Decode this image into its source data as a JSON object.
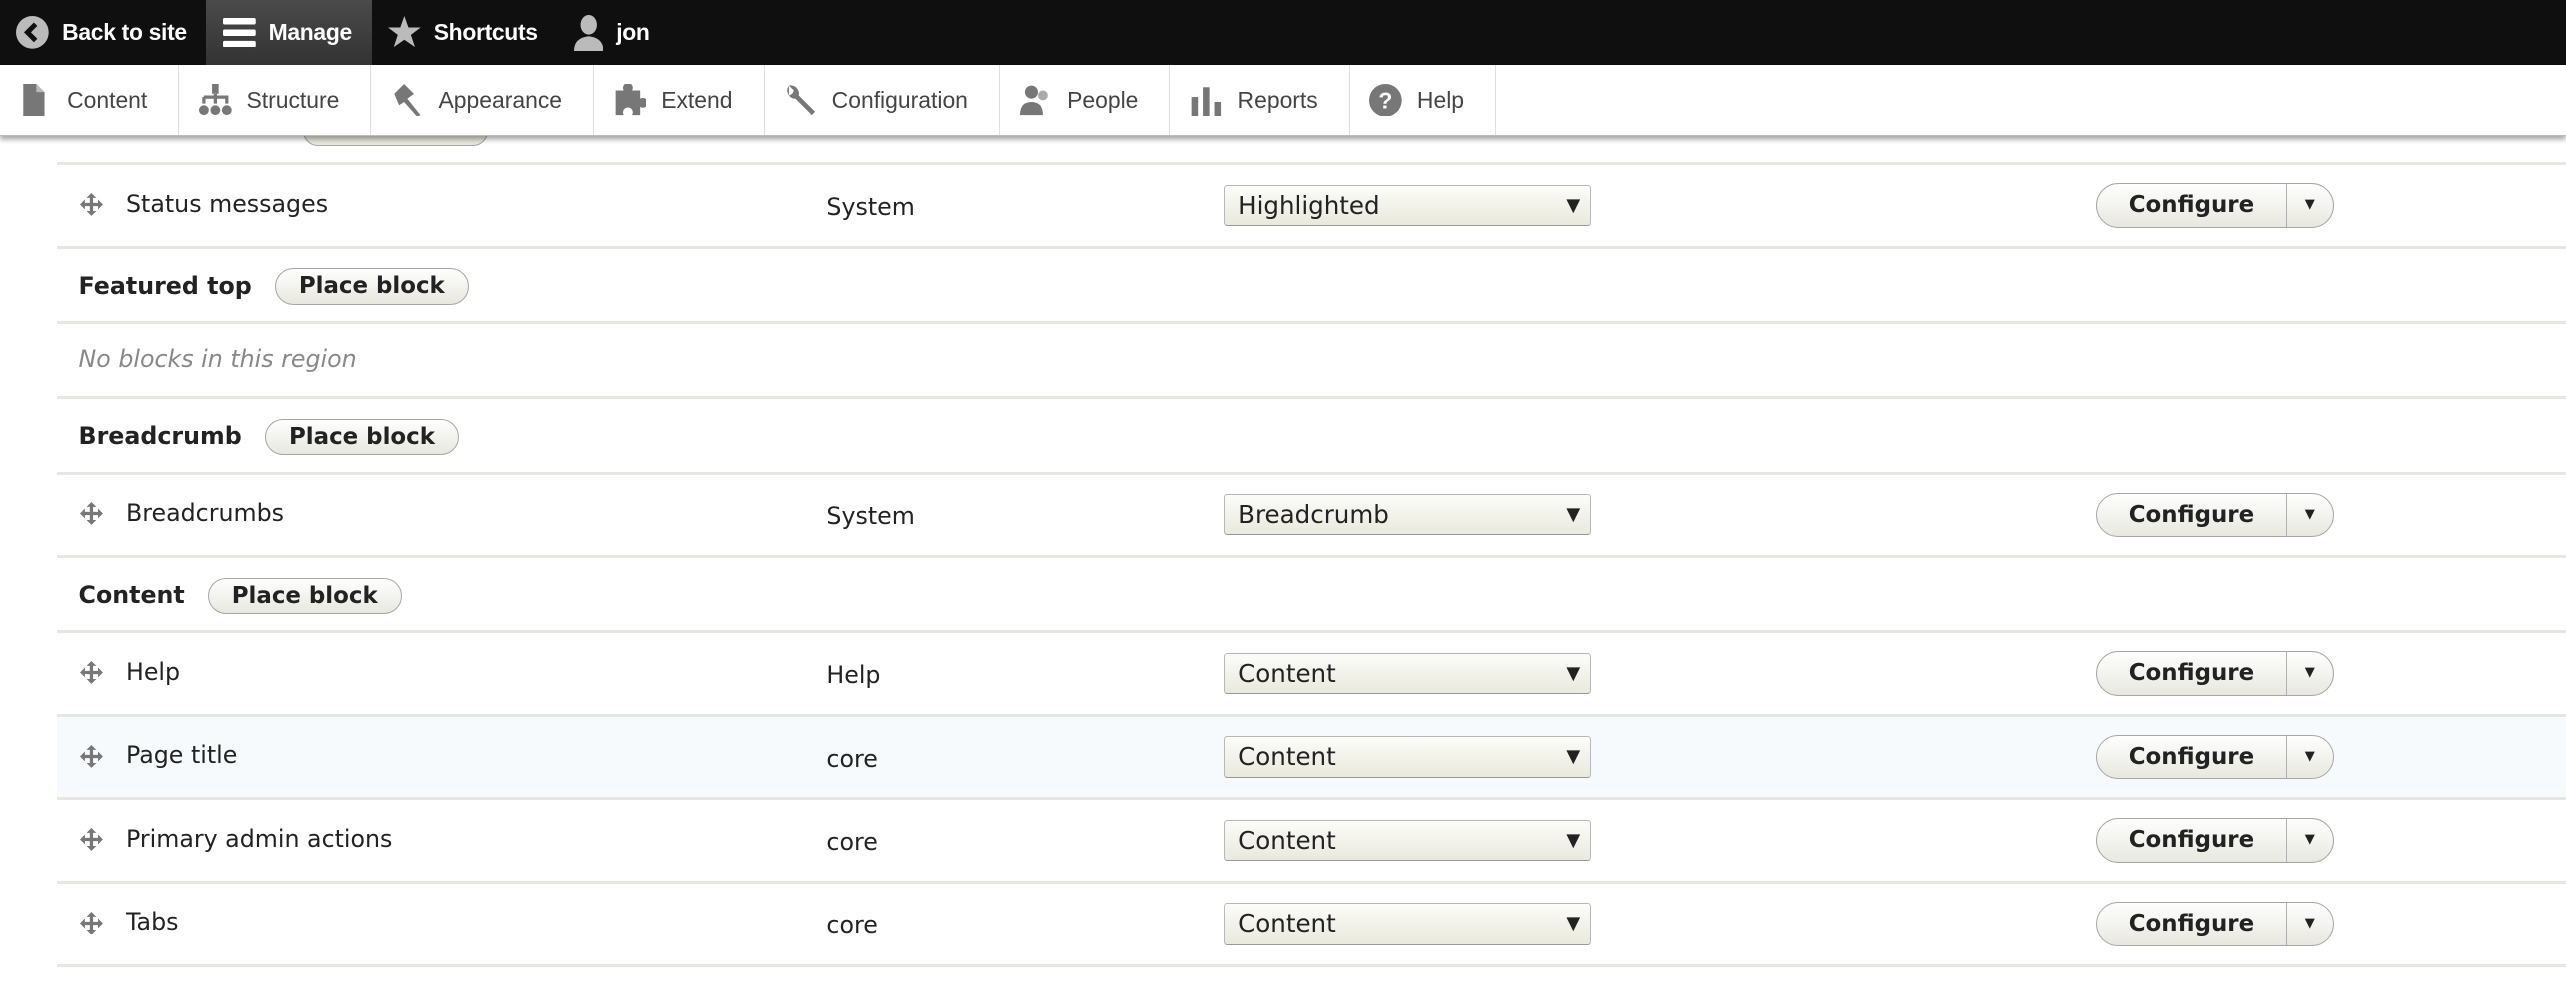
{
  "toolbar": {
    "back": "Back to site",
    "manage": "Manage",
    "shortcuts": "Shortcuts",
    "user": "jon"
  },
  "tray": [
    {
      "label": "Content",
      "icon": "file-icon"
    },
    {
      "label": "Structure",
      "icon": "sitemap-icon"
    },
    {
      "label": "Appearance",
      "icon": "paintbrush-icon"
    },
    {
      "label": "Extend",
      "icon": "puzzle-icon"
    },
    {
      "label": "Configuration",
      "icon": "wrench-icon"
    },
    {
      "label": "People",
      "icon": "people-icon"
    },
    {
      "label": "Reports",
      "icon": "bar-chart-icon"
    },
    {
      "label": "Help",
      "icon": "help-icon"
    }
  ],
  "common": {
    "configure": "Configure",
    "place_block": "Place block",
    "empty": "No blocks in this region"
  },
  "rows": [
    {
      "type": "block",
      "name": "Status messages",
      "category": "System",
      "region": "Highlighted"
    },
    {
      "type": "region",
      "title": "Featured top"
    },
    {
      "type": "empty"
    },
    {
      "type": "region",
      "title": "Breadcrumb"
    },
    {
      "type": "block",
      "name": "Breadcrumbs",
      "category": "System",
      "region": "Breadcrumb"
    },
    {
      "type": "region",
      "title": "Content"
    },
    {
      "type": "block",
      "name": "Help",
      "category": "Help",
      "region": "Content"
    },
    {
      "type": "block",
      "name": "Page title",
      "category": "core",
      "region": "Content",
      "highlighted": true
    },
    {
      "type": "block",
      "name": "Primary admin actions",
      "category": "core",
      "region": "Content"
    },
    {
      "type": "block",
      "name": "Tabs",
      "category": "core",
      "region": "Content"
    }
  ]
}
